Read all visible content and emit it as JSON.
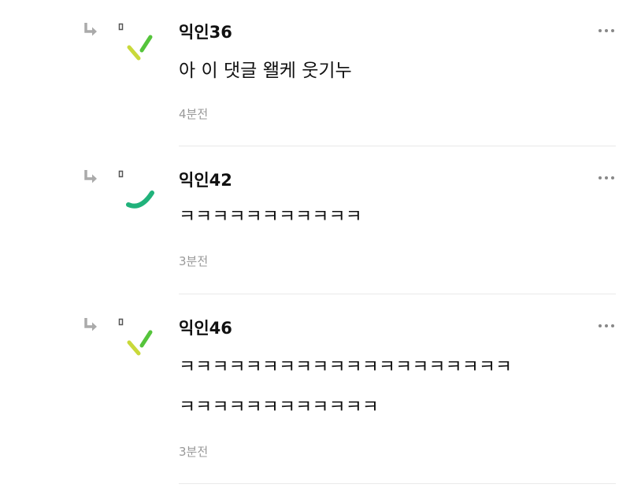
{
  "comments": [
    {
      "nickname": "익인36",
      "lines": [
        "아 이 댓글 왤케 웃기누"
      ],
      "time": "4분전",
      "avatar": "lime-dashes"
    },
    {
      "nickname": "익인42",
      "lines": [
        "ㅋㅋㅋㅋㅋㅋㅋㅋㅋㅋㅋ"
      ],
      "time": "3분전",
      "avatar": "green-arc"
    },
    {
      "nickname": "익인46",
      "lines": [
        "ㅋㅋㅋㅋㅋㅋㅋㅋㅋㅋㅋㅋㅋㅋㅋㅋㅋㅋㅋㅋ",
        "ㅋㅋㅋㅋㅋㅋㅋㅋㅋㅋㅋㅋ"
      ],
      "time": "3분전",
      "avatar": "lime-dashes"
    }
  ],
  "icons": {
    "reply": "reply-arrow-icon",
    "more": "more-options-icon"
  },
  "colors": {
    "avatar_lime": "#c9d93a",
    "avatar_green": "#55c43b",
    "avatar_teal": "#20b27b",
    "timestamp": "#999999",
    "divider": "#e9e9e9"
  }
}
